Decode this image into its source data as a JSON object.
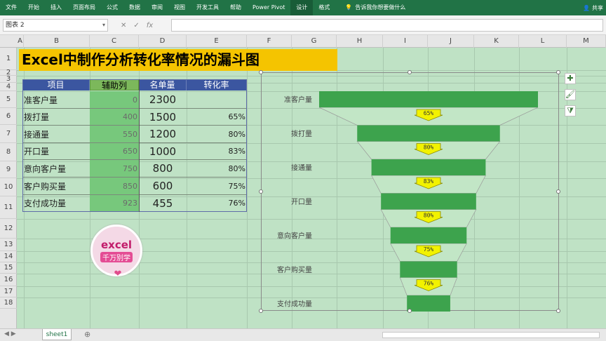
{
  "ribbon": {
    "tabs": [
      "文件",
      "开始",
      "插入",
      "页面布局",
      "公式",
      "数据",
      "审阅",
      "视图",
      "开发工具",
      "帮助",
      "Power Pivot",
      "设计",
      "格式"
    ],
    "active_tab": "设计",
    "tell_me": "告诉我你想要做什么",
    "share": "共享"
  },
  "formula_bar": {
    "name_box": "图表 2",
    "fx": "fx",
    "content": ""
  },
  "columns": [
    "A",
    "B",
    "C",
    "D",
    "E",
    "F",
    "G",
    "H",
    "I",
    "J",
    "K",
    "L",
    "M"
  ],
  "rows": [
    "1",
    "2",
    "3",
    "4",
    "5",
    "6",
    "7",
    "8",
    "9",
    "10",
    "11",
    "12",
    "13",
    "14",
    "15",
    "16",
    "17",
    "18"
  ],
  "title": "Excel中制作分析转化率情况的漏斗图",
  "table": {
    "headers": [
      "项目",
      "辅助列",
      "名单量",
      "转化率"
    ],
    "rows": [
      {
        "name": "准客户量",
        "aux": "0",
        "count": "2300",
        "rate": ""
      },
      {
        "name": "拨打量",
        "aux": "400",
        "count": "1500",
        "rate": "65%"
      },
      {
        "name": "接通量",
        "aux": "550",
        "count": "1200",
        "rate": "80%"
      },
      {
        "name": "开口量",
        "aux": "650",
        "count": "1000",
        "rate": "83%"
      },
      {
        "name": "意向客户量",
        "aux": "750",
        "count": "800",
        "rate": "80%"
      },
      {
        "name": "客户购买量",
        "aux": "850",
        "count": "600",
        "rate": "75%"
      },
      {
        "name": "支付成功量",
        "aux": "923",
        "count": "455",
        "rate": "76%"
      }
    ]
  },
  "chart_data": {
    "type": "bar",
    "categories": [
      "准客户量",
      "拨打量",
      "接通量",
      "开口量",
      "意向客户量",
      "客户购买量",
      "支付成功量"
    ],
    "offset": [
      0,
      400,
      550,
      650,
      750,
      850,
      923
    ],
    "values": [
      2300,
      1500,
      1200,
      1000,
      800,
      600,
      455
    ],
    "rates": [
      "65%",
      "80%",
      "83%",
      "80%",
      "75%",
      "76%"
    ],
    "bar_color": "#3da34d",
    "arrow_color": "#f2f200",
    "xlim": [
      0,
      2300
    ]
  },
  "logo": {
    "line1": "excel",
    "line2": "千万别学"
  },
  "sheet": {
    "name": "sheet1"
  }
}
